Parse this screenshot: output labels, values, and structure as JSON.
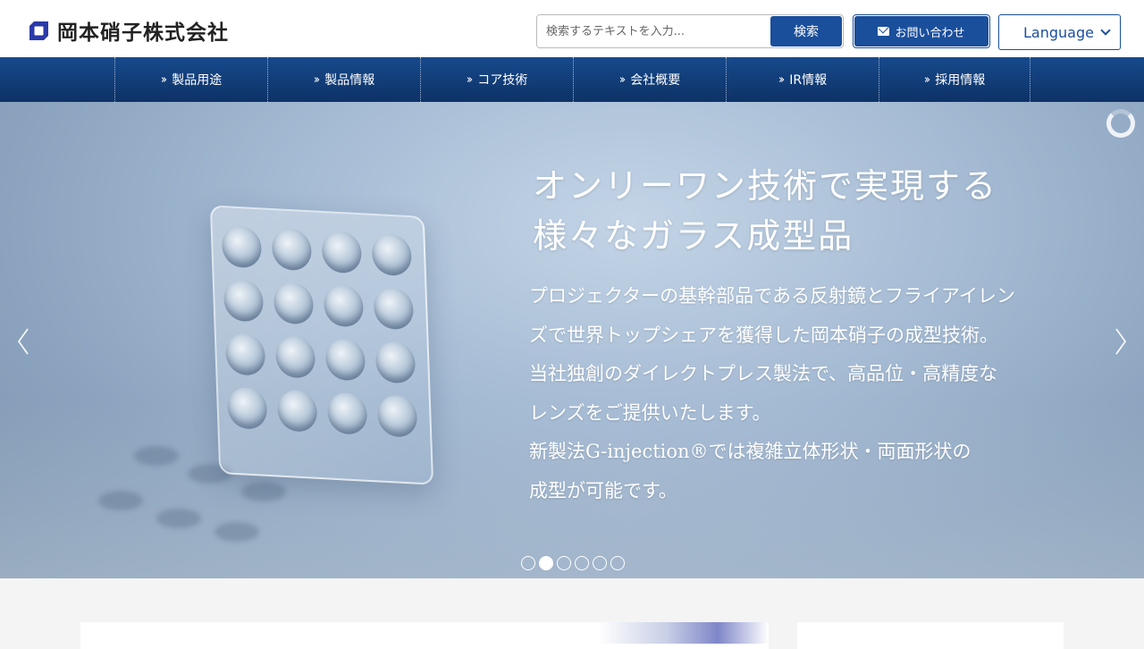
{
  "header": {
    "company_name": "岡本硝子株式会社",
    "search_placeholder": "検索するテキストを入力...",
    "search_button": "検索",
    "contact_button": "お問い合わせ",
    "language_select": "Language"
  },
  "nav": {
    "items": [
      {
        "label": "製品用途"
      },
      {
        "label": "製品情報"
      },
      {
        "label": "コア技術"
      },
      {
        "label": "会社概要"
      },
      {
        "label": "IR情報"
      },
      {
        "label": "採用情報"
      }
    ]
  },
  "hero": {
    "title_line1": "オンリーワン技術で実現する",
    "title_line2": "様々なガラス成型品",
    "body_lines": [
      "プロジェクターの基幹部品である反射鏡とフライアイレン",
      "ズで世界トップシェアを獲得した岡本硝子の成型技術。",
      "当社独創のダイレクトプレス製法で、高品位・高精度な",
      "レンズをご提供いたします。",
      "新製法G-injection®では複雑立体形状・両面形状の",
      "成型が可能です。"
    ],
    "slide_count": 6,
    "active_slide": 2
  },
  "colors": {
    "brand": "#1a4f9c",
    "nav_top": "#174a8c",
    "nav_bottom": "#0d3266"
  }
}
